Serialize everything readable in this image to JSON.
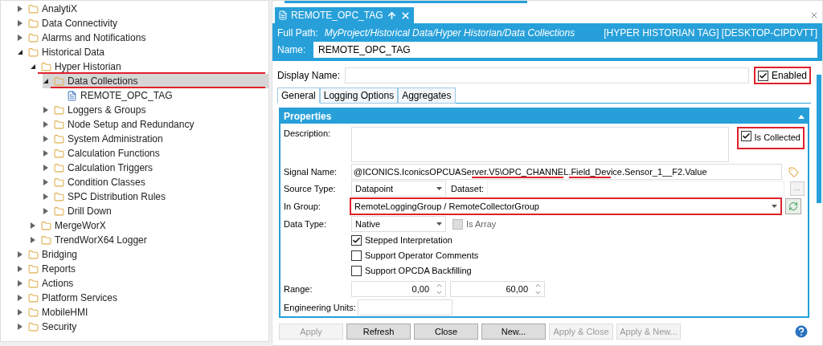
{
  "tree": [
    {
      "label": "AnalytiX",
      "expanded": false,
      "selected": false,
      "marked": false
    },
    {
      "label": "Data Connectivity",
      "expanded": false,
      "selected": false,
      "marked": false
    },
    {
      "label": "Alarms and Notifications",
      "expanded": false,
      "selected": false,
      "marked": false
    },
    {
      "label": "Historical Data",
      "expanded": true,
      "selected": false,
      "marked": false,
      "children": [
        {
          "label": "Hyper Historian",
          "expanded": true,
          "selected": false,
          "marked": true,
          "children": [
            {
              "label": "Data Collections",
              "expanded": true,
              "selected": true,
              "marked": true,
              "children": [
                {
                  "label": "REMOTE_OPC_TAG",
                  "selected": false,
                  "marked": false
                }
              ]
            },
            {
              "label": "Loggers & Groups",
              "expanded": false,
              "selected": false,
              "marked": false
            },
            {
              "label": "Node Setup and Redundancy",
              "expanded": false,
              "selected": false,
              "marked": false
            },
            {
              "label": "System Administration",
              "expanded": false,
              "selected": false,
              "marked": false
            },
            {
              "label": "Calculation Functions",
              "expanded": false,
              "selected": false,
              "marked": false
            },
            {
              "label": "Calculation Triggers",
              "expanded": false,
              "selected": false,
              "marked": false
            },
            {
              "label": "Condition Classes",
              "expanded": false,
              "selected": false,
              "marked": false
            },
            {
              "label": "SPC Distribution Rules",
              "expanded": false,
              "selected": false,
              "marked": false
            },
            {
              "label": "Drill Down",
              "expanded": false,
              "selected": false,
              "marked": false
            }
          ]
        },
        {
          "label": "MergeWorX",
          "expanded": false,
          "selected": false,
          "marked": false
        },
        {
          "label": "TrendWorX64 Logger",
          "expanded": false,
          "selected": false,
          "marked": false
        }
      ]
    },
    {
      "label": "Bridging",
      "expanded": false,
      "selected": false,
      "marked": false
    },
    {
      "label": "Reports",
      "expanded": false,
      "selected": false,
      "marked": false
    },
    {
      "label": "Actions",
      "expanded": false,
      "selected": false,
      "marked": false
    },
    {
      "label": "Platform Services",
      "expanded": false,
      "selected": false,
      "marked": false
    },
    {
      "label": "MobileHMI",
      "expanded": false,
      "selected": false,
      "marked": false
    },
    {
      "label": "Security",
      "expanded": false,
      "selected": false,
      "marked": false
    }
  ],
  "document_tab": {
    "title": "REMOTE_OPC_TAG"
  },
  "header": {
    "full_path_label": "Full Path:",
    "full_path": "MyProject/Historical Data/Hyper Historian/Data Collections",
    "type_info": "[HYPER HISTORIAN TAG] [DESKTOP-CIPDVTT]",
    "name_label": "Name:",
    "name": "REMOTE_OPC_TAG"
  },
  "display_name": {
    "label": "Display Name:"
  },
  "enabled": {
    "label": "Enabled",
    "checked": true,
    "marked": true
  },
  "tabs": [
    {
      "label": "General",
      "selected": true
    },
    {
      "label": "Logging Options",
      "selected": false
    },
    {
      "label": "Aggregates",
      "selected": false
    }
  ],
  "properties": {
    "title": "Properties",
    "description_label": "Description:",
    "is_collected": {
      "label": "Is Collected",
      "checked": true,
      "marked": true
    },
    "signal_name_label": "Signal Name:",
    "signal_name": "@ICONICS.IconicsOPCUAServer.V5\\OPC_CHANNEL.Field_Device.Sensor_1__F2.Value",
    "source_type_label": "Source Type:",
    "source_type": "Datapoint",
    "dataset_label": "Dataset:",
    "browse_button": "...",
    "in_group_label": "In Group:",
    "in_group": "RemoteLoggingGroup / RemoteCollectorGroup",
    "in_group_marked": true,
    "data_type_label": "Data Type:",
    "data_type": "Native",
    "is_array": {
      "label": "Is Array",
      "checked": false,
      "disabled": true
    },
    "options": [
      {
        "label": "Stepped Interpretation",
        "checked": true
      },
      {
        "label": "Support Operator Comments",
        "checked": false
      },
      {
        "label": "Support OPCDA Backfilling",
        "checked": false
      }
    ],
    "range_label": "Range:",
    "range_min": "0,00",
    "range_max": "60,00",
    "engineering_units_label": "Engineering Units:"
  },
  "buttons": [
    {
      "label": "Apply",
      "disabled": true
    },
    {
      "label": "Refresh",
      "disabled": false
    },
    {
      "label": "Close",
      "disabled": false
    },
    {
      "label": "New...",
      "disabled": false
    },
    {
      "label": "Apply & Close",
      "disabled": true
    },
    {
      "label": "Apply & New...",
      "disabled": true
    }
  ]
}
